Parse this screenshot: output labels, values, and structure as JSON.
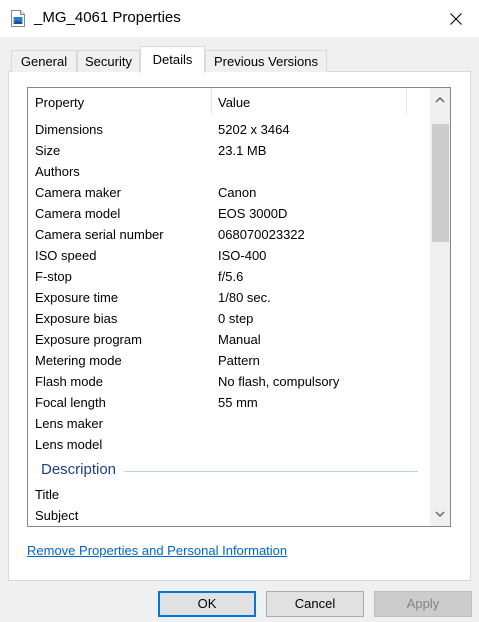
{
  "window": {
    "title": "_MG_4061 Properties",
    "close_label": "✕"
  },
  "tabs": [
    {
      "label": "General"
    },
    {
      "label": "Security"
    },
    {
      "label": "Details"
    },
    {
      "label": "Previous Versions"
    }
  ],
  "details": {
    "columns": {
      "property": "Property",
      "value": "Value"
    },
    "rows": [
      {
        "k": "Dimensions",
        "v": "5202 x 3464"
      },
      {
        "k": "Size",
        "v": "23.1 MB"
      },
      {
        "k": "Authors",
        "v": ""
      },
      {
        "k": "Camera maker",
        "v": "Canon"
      },
      {
        "k": "Camera model",
        "v": "EOS 3000D"
      },
      {
        "k": "Camera serial number",
        "v": "068070023322"
      },
      {
        "k": "ISO speed",
        "v": "ISO-400"
      },
      {
        "k": "F-stop",
        "v": "f/5.6"
      },
      {
        "k": "Exposure time",
        "v": "1/80 sec."
      },
      {
        "k": "Exposure bias",
        "v": "0 step"
      },
      {
        "k": "Exposure program",
        "v": "Manual"
      },
      {
        "k": "Metering mode",
        "v": "Pattern"
      },
      {
        "k": "Flash mode",
        "v": "No flash, compulsory"
      },
      {
        "k": "Focal length",
        "v": "55 mm"
      },
      {
        "k": "Lens maker",
        "v": ""
      },
      {
        "k": "Lens model",
        "v": ""
      }
    ],
    "group": "Description",
    "group_rows": [
      {
        "k": "Title",
        "v": ""
      },
      {
        "k": "Subject",
        "v": ""
      }
    ]
  },
  "remove_link": "Remove Properties and Personal Information",
  "buttons": {
    "ok": "OK",
    "cancel": "Cancel",
    "apply": "Apply"
  },
  "colors": {
    "accent": "#0078d7",
    "link": "#0066cc",
    "group_title": "#1e3f8a"
  }
}
